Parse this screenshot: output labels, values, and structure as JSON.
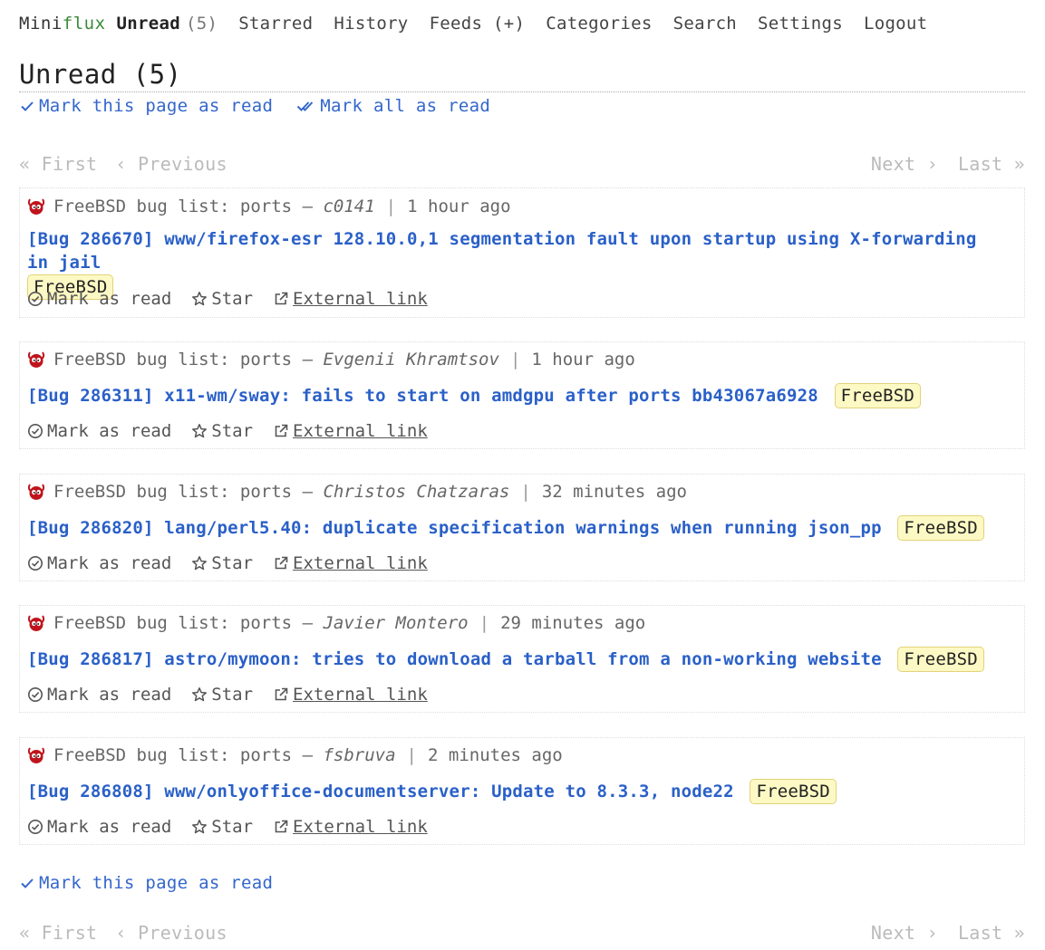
{
  "header": {
    "logo_part1": "Mini",
    "logo_part2": "flux",
    "nav": {
      "unread": "Unread",
      "unread_count": "(5)",
      "starred": "Starred",
      "history": "History",
      "feeds": "Feeds (+)",
      "categories": "Categories",
      "search": "Search",
      "settings": "Settings",
      "logout": "Logout"
    }
  },
  "page": {
    "title": "Unread (5)",
    "mark_page_read": "Mark this page as read",
    "mark_all_read": "Mark all as read"
  },
  "pagination": {
    "first": "« First",
    "previous": "‹ Previous",
    "next": "Next ›",
    "last": "Last »"
  },
  "entry_actions": {
    "mark_as_read": "Mark as read",
    "star": "Star",
    "external_link": "External link"
  },
  "entries": [
    {
      "feed": "FreeBSD bug list: ports",
      "dash": "–",
      "author": "c0141",
      "pipe": "|",
      "time": "1 hour ago",
      "title": "[Bug 286670] www/firefox-esr 128.10.0,1 segmentation fault upon startup using X-forwarding in jail",
      "tag": "FreeBSD"
    },
    {
      "feed": "FreeBSD bug list: ports",
      "dash": "–",
      "author": "Evgenii Khramtsov",
      "pipe": "|",
      "time": "1 hour ago",
      "title": "[Bug 286311] x11-wm/sway: fails to start on amdgpu after ports bb43067a6928",
      "tag": "FreeBSD"
    },
    {
      "feed": "FreeBSD bug list: ports",
      "dash": "–",
      "author": "Christos Chatzaras",
      "pipe": "|",
      "time": "32 minutes ago",
      "title": "[Bug 286820] lang/perl5.40: duplicate specification warnings when running json_pp",
      "tag": "FreeBSD"
    },
    {
      "feed": "FreeBSD bug list: ports",
      "dash": "–",
      "author": "Javier Montero",
      "pipe": "|",
      "time": "29 minutes ago",
      "title": "[Bug 286817] astro/mymoon: tries to download a tarball from a non-working website",
      "tag": "FreeBSD"
    },
    {
      "feed": "FreeBSD bug list: ports",
      "dash": "–",
      "author": "fsbruva",
      "pipe": "|",
      "time": "2 minutes ago",
      "title": "[Bug 286808] www/onlyoffice-documentserver: Update to 8.3.3, node22",
      "tag": "FreeBSD"
    }
  ]
}
